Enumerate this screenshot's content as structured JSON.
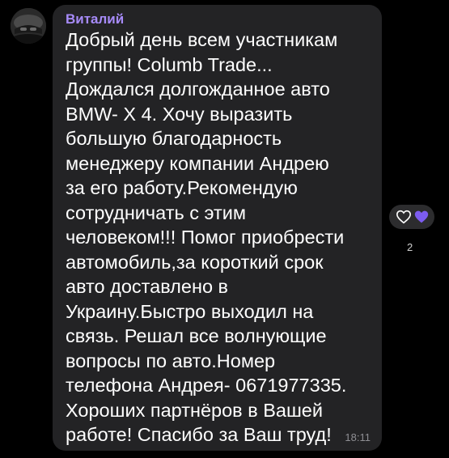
{
  "message": {
    "sender": "Виталий",
    "text": "Добрый день всем участникам\nгруппы! Columb Trade...\nДождался долгожданное авто\nBMW- X 4. Хочу выразить\nбольшую благодарность\nменеджеру компании Андрею\nза его работу.Рекомендую\nсотрудничать с этим\nчеловеком!!! Помог приобрести\nавтомобиль,за короткий срок\nавто доставлено в\nУкраину.Быстро выходил на\nсвязь. Решал все волнующие\nвопросы по авто.Номер\nтелефона Андрея- 0671977335.\nХороших партнёров в Вашей\nработе! Спасибо за Ваш труд!",
    "time": "18:11"
  },
  "reactions": {
    "count": "2",
    "icons": [
      "heart-outline-icon",
      "heart-filled-icon"
    ]
  },
  "colors": {
    "background": "#000000",
    "bubble": "#232325",
    "sender": "#a78bfa",
    "text": "#ffffff",
    "time": "#8e8e93",
    "reaction_accent": "#7c5cf0"
  }
}
